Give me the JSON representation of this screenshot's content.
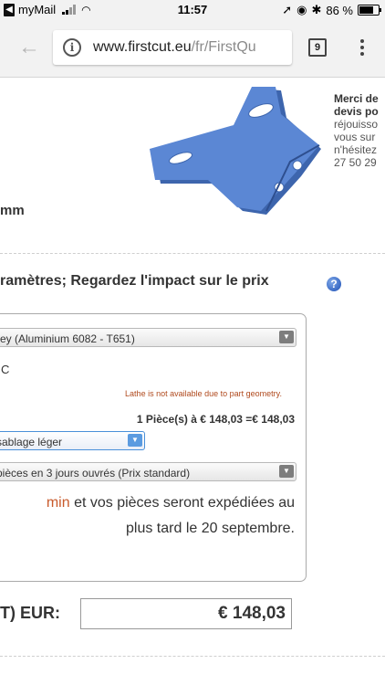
{
  "status_bar": {
    "app_name": "myMail",
    "time": "11:57",
    "battery": "86 %",
    "battery_level": 0.86
  },
  "browser": {
    "url_host": "www.firstcut.eu",
    "url_path": "/fr/FirstQu",
    "tab_count": "9"
  },
  "header": {
    "merci_line1": "Merci de",
    "merci_line2": "devis po",
    "merci_line3": "réjouisso",
    "merci_line4": "vous sur",
    "merci_line5": "n'hésitez",
    "merci_line6": "27 50 29",
    "dimension_unit": "mm"
  },
  "parameters": {
    "title": "ramètres; Regardez l'impact sur le prix",
    "help_label": "?",
    "material_value": "rey (Aluminium 6082 - T651)",
    "process_text": "C",
    "lathe_note": "Lathe is not available due to part geometry.",
    "price_line": "1 Pièce(s) à € 148,03 =€ 148,03",
    "finish_value": "sablage léger",
    "delivery_value": "pièces en 3 jours ouvrés (Prix standard)",
    "ship_accent": "min",
    "ship_line1_rest": " et vos pièces seront expédiées au",
    "ship_line2": "plus tard le 20 septembre."
  },
  "total": {
    "label": "T) EUR:",
    "value": "€ 148,03"
  },
  "colors": {
    "part_blue": "#5b87d4",
    "accent_orange": "#c85a2b",
    "lathe_note": "#b04a1e"
  }
}
